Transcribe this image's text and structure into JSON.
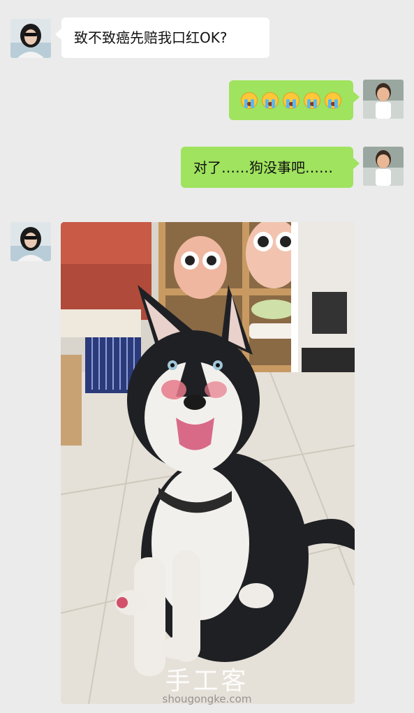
{
  "messages": [
    {
      "side": "left",
      "text": "致不致癌先赔我口红OK?"
    },
    {
      "side": "right",
      "emoji": [
        "crying-face",
        "crying-face",
        "crying-face",
        "crying-face",
        "crying-face"
      ]
    },
    {
      "side": "right",
      "text": "对了……狗没事吧……"
    },
    {
      "side": "left",
      "image": "husky-photo"
    }
  ],
  "watermark": {
    "cn": "手工客",
    "en": "shougongke.com"
  },
  "colors": {
    "background": "#ebebeb",
    "sent_bubble": "#9fe35e",
    "received_bubble": "#ffffff"
  }
}
